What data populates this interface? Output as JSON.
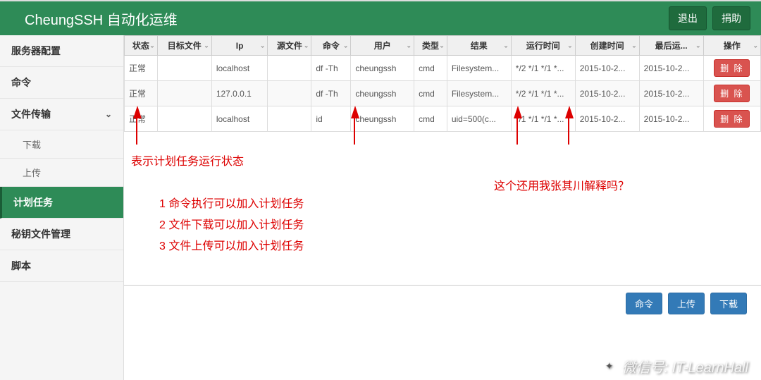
{
  "header": {
    "title": "CheungSSH 自动化运维",
    "logout": "退出",
    "donate": "捐助"
  },
  "sidebar": {
    "items": [
      {
        "label": "服务器配置"
      },
      {
        "label": "命令"
      },
      {
        "label": "文件传输",
        "expanded": true
      },
      {
        "label": "计划任务",
        "active": true
      },
      {
        "label": "秘钥文件管理"
      },
      {
        "label": "脚本"
      }
    ],
    "subitems": [
      {
        "label": "下载"
      },
      {
        "label": "上传"
      }
    ]
  },
  "table": {
    "columns": [
      "状态",
      "目标文件",
      "Ip",
      "源文件",
      "命令",
      "用户",
      "类型",
      "结果",
      "运行时间",
      "创建时间",
      "最后运...",
      "操作"
    ],
    "rows": [
      {
        "status": "正常",
        "dest": "",
        "ip": "localhost",
        "src": "",
        "cmd": "df -Th",
        "user": "cheungssh",
        "type": "cmd",
        "result": "Filesystem...",
        "runtime": "*/2 */1 */1 *...",
        "ctime": "2015-10-2...",
        "ltime": "2015-10-2...",
        "del": "删 除"
      },
      {
        "status": "正常",
        "dest": "",
        "ip": "127.0.0.1",
        "src": "",
        "cmd": "df -Th",
        "user": "cheungssh",
        "type": "cmd",
        "result": "Filesystem...",
        "runtime": "*/2 */1 */1 *...",
        "ctime": "2015-10-2...",
        "ltime": "2015-10-2...",
        "del": "删 除"
      },
      {
        "status": "正常",
        "dest": "",
        "ip": "localhost",
        "src": "",
        "cmd": "id",
        "user": "cheungssh",
        "type": "cmd",
        "result": "uid=500(c...",
        "runtime": "*/1 */1 */1 *...",
        "ctime": "2015-10-2...",
        "ltime": "2015-10-2...",
        "del": "删 除"
      }
    ]
  },
  "footer": {
    "cmd": "命令",
    "upload": "上传",
    "download": "下载"
  },
  "annotations": {
    "a1": "表示计划任务运行状态",
    "a2": "1 命令执行可以加入计划任务",
    "a3": "2 文件下载可以加入计划任务",
    "a4": "3 文件上传可以加入计划任务",
    "a5": "这个还用我张其川解释吗？"
  },
  "watermark": "微信号: IT-LearnHall"
}
